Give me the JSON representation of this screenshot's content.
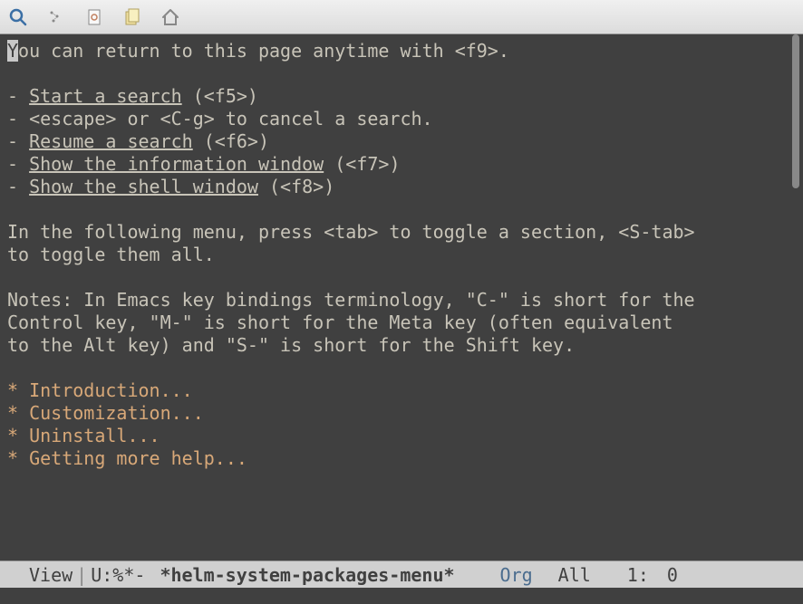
{
  "toolbar": {
    "icons": [
      "search-icon",
      "repeat-icon",
      "document-icon",
      "copy-icon",
      "home-icon"
    ]
  },
  "content": {
    "line1_pre": "Y",
    "line1_post": "ou can return to this page anytime with <f9>.",
    "bullet": "- ",
    "link_start_search": "Start a search",
    "link_start_search_suffix": " (<f5>)",
    "line_escape": "- <escape> or <C-g> to cancel a search.",
    "link_resume": "Resume a search",
    "link_resume_suffix": " (<f6>)",
    "link_info": "Show the information window",
    "link_info_suffix": " (<f7>)",
    "link_shell": "Show the shell window",
    "link_shell_suffix": " (<f8>)",
    "para2_l1": "In the following menu, press <tab> to toggle a section, <S-tab>",
    "para2_l2": "to toggle them all.",
    "notes_l1": "Notes: In Emacs key bindings terminology, \"C-\" is short for the",
    "notes_l2": "Control key, \"M-\" is short for the Meta key (often equivalent",
    "notes_l3": "to the Alt key) and \"S-\" is short for the Shift key.",
    "headings": [
      "* Introduction...",
      "* Customization...",
      "* Uninstall...",
      "* Getting more help..."
    ]
  },
  "modeline": {
    "view": "View",
    "status": "U:%*-",
    "buffer": "*helm-system-packages-menu*",
    "mode": "Org",
    "scroll": "All",
    "line": "1:",
    "col": "0"
  }
}
